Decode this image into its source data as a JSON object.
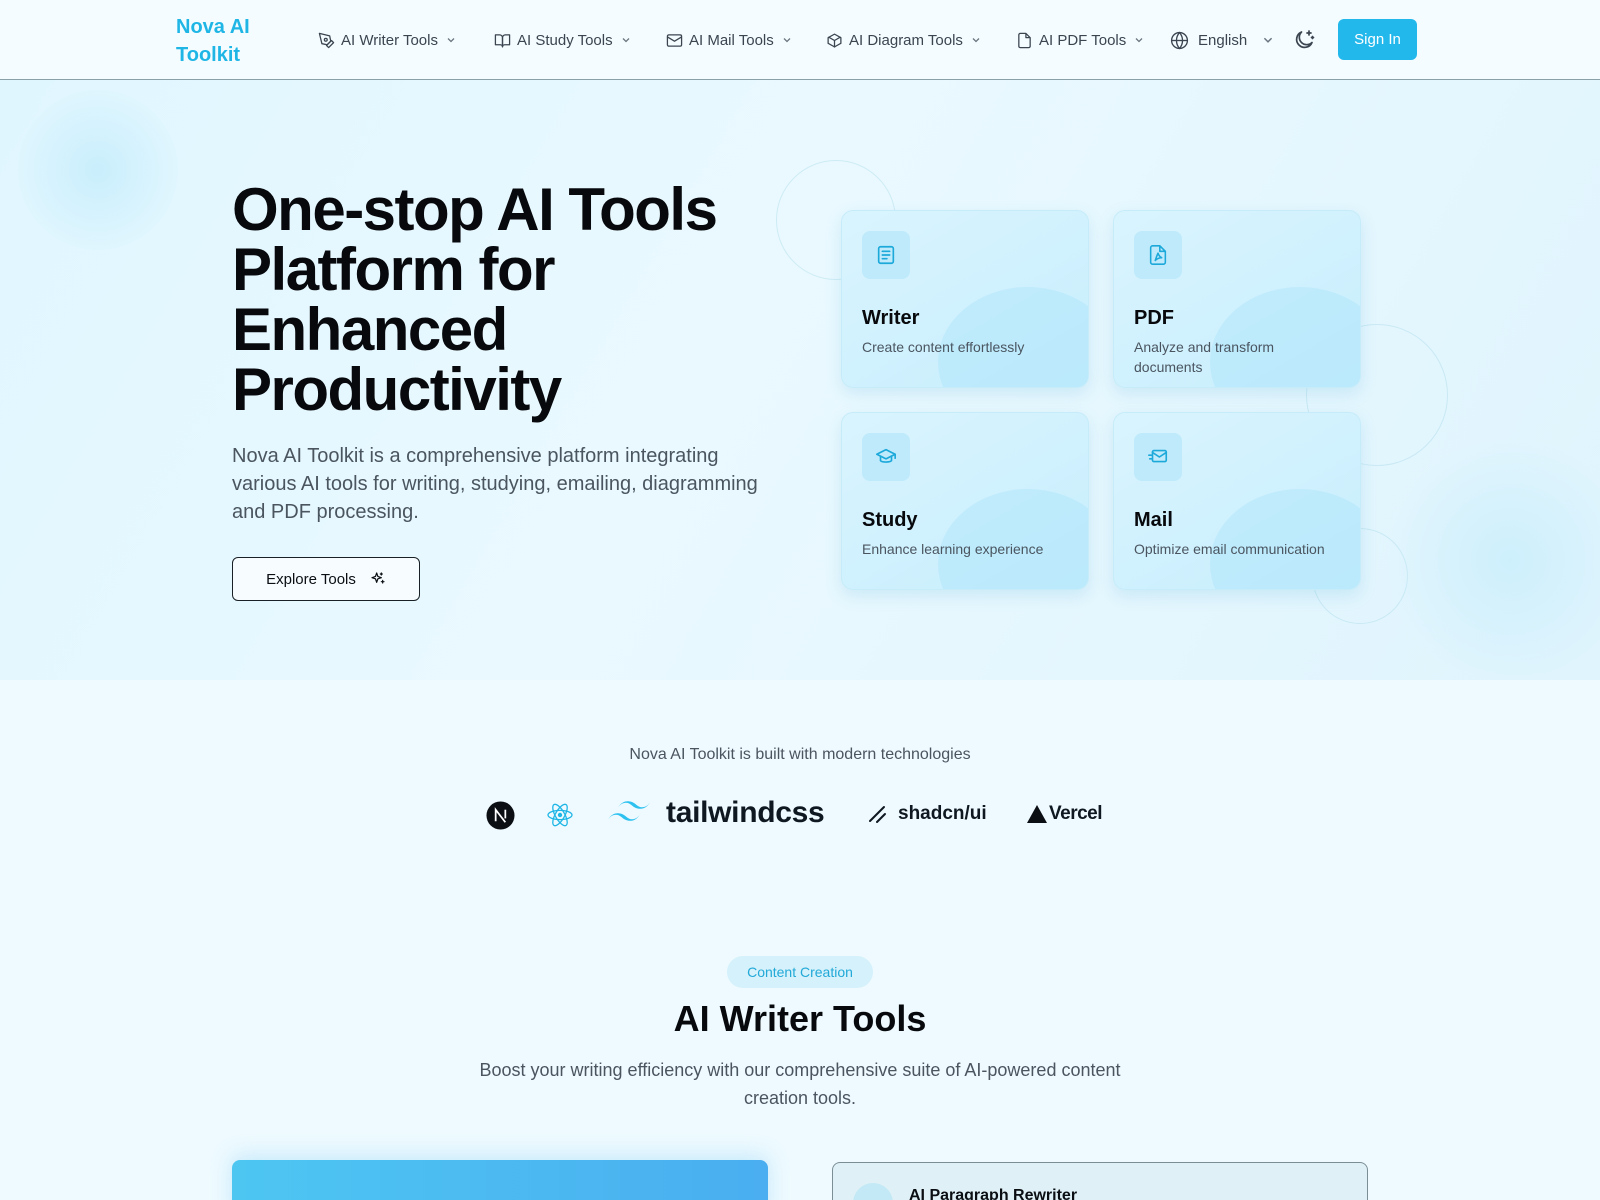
{
  "header": {
    "logo": "Nova AI Toolkit",
    "nav": [
      {
        "label": "AI Writer Tools",
        "icon": "pen-tool-icon"
      },
      {
        "label": "AI Study Tools",
        "icon": "book-open-icon"
      },
      {
        "label": "AI Mail Tools",
        "icon": "mail-icon"
      },
      {
        "label": "AI Diagram Tools",
        "icon": "box-icon"
      },
      {
        "label": "AI PDF Tools",
        "icon": "file-icon"
      }
    ],
    "language": "English",
    "sign_in": "Sign In"
  },
  "hero": {
    "title": "One-stop AI Tools Platform for Enhanced Productivity",
    "description": "Nova AI Toolkit is a comprehensive platform integrating various AI tools for writing, studying, emailing, diagramming and PDF processing.",
    "cta": "Explore Tools",
    "cards": [
      {
        "title": "Writer",
        "desc": "Create content effortlessly",
        "icon": "document-text-icon"
      },
      {
        "title": "PDF",
        "desc": "Analyze and transform documents",
        "icon": "file-pdf-icon"
      },
      {
        "title": "Study",
        "desc": "Enhance learning experience",
        "icon": "graduation-cap-icon"
      },
      {
        "title": "Mail",
        "desc": "Optimize email communication",
        "icon": "mail-send-icon"
      }
    ]
  },
  "tech": {
    "built_with": "Nova AI Toolkit is built with modern technologies",
    "tailwind": "tailwindcss",
    "shadcn": "shadcn/ui",
    "vercel": "Vercel"
  },
  "writer_section": {
    "badge": "Content Creation",
    "title": "AI Writer Tools",
    "description": "Boost your writing efficiency with our comprehensive suite of AI-powered content creation tools.",
    "panel_right_title": "AI Paragraph Rewriter"
  },
  "colors": {
    "accent": "#22b8ec",
    "logo": "#1fb6e6"
  }
}
